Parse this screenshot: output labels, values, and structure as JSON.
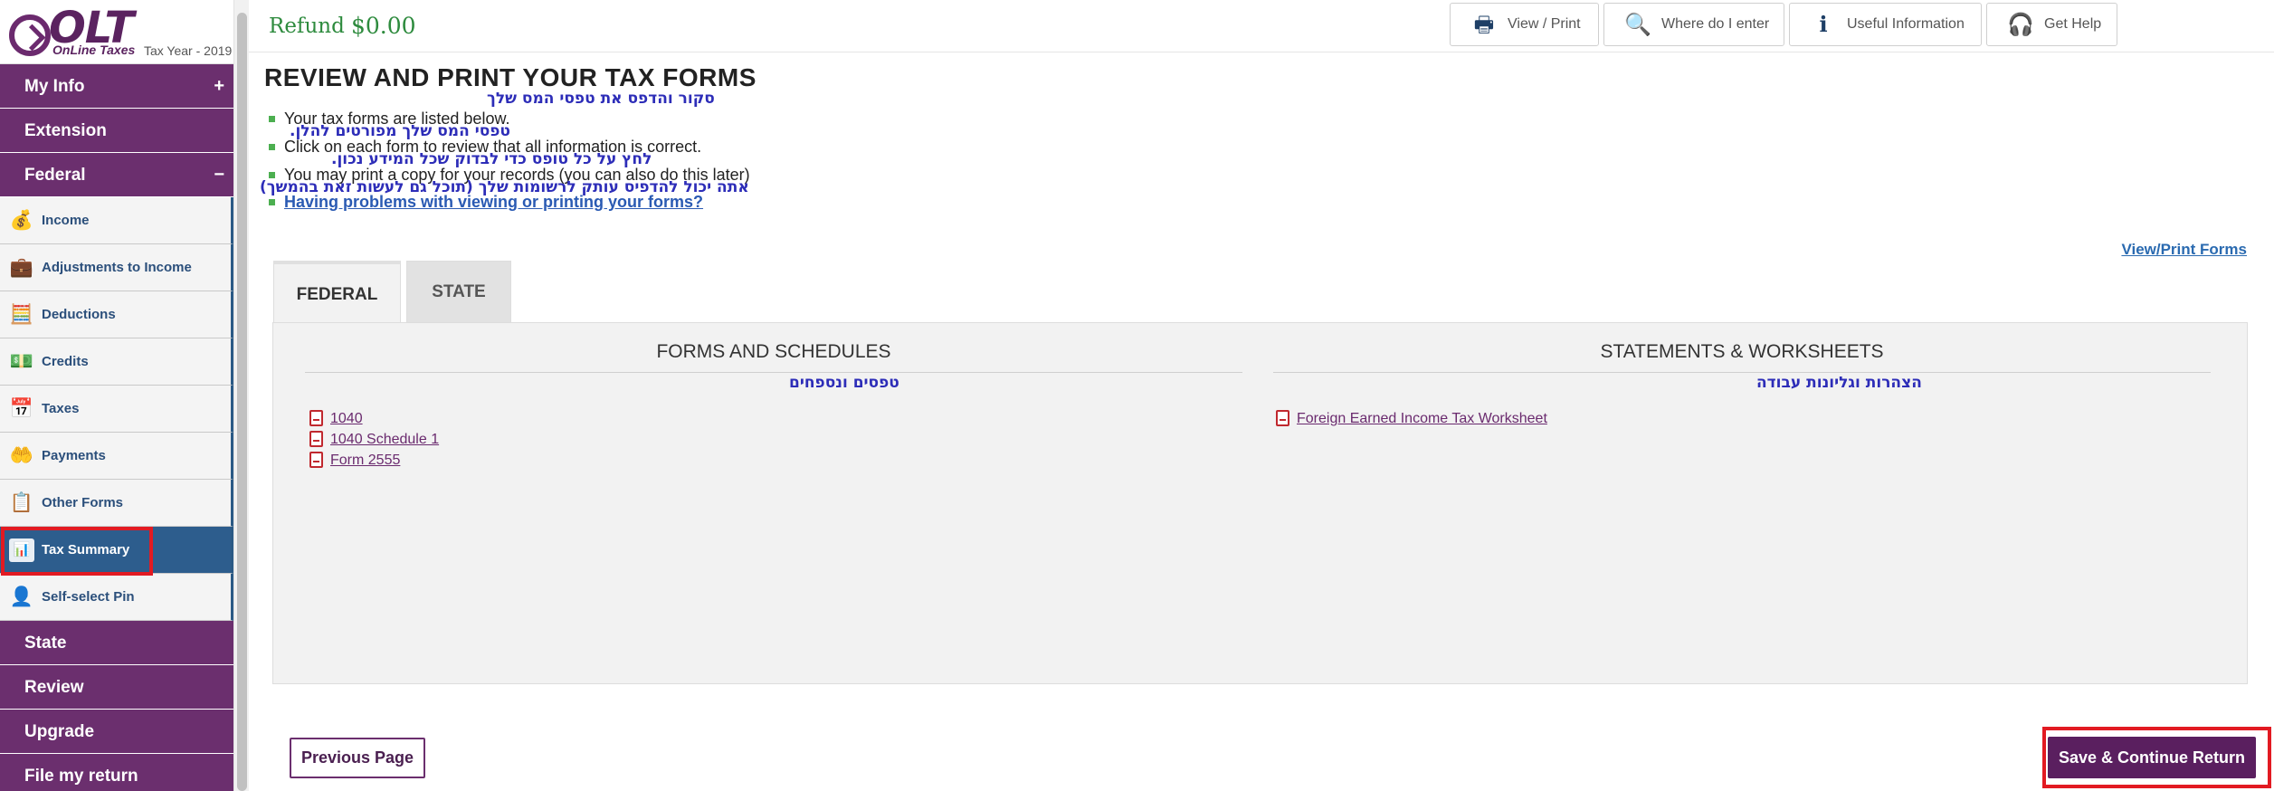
{
  "logo": {
    "brand": "OLT",
    "tagline": "OnLine Taxes",
    "tax_year": "Tax Year - 2019"
  },
  "sidebar": {
    "items": [
      {
        "label": "My Info",
        "type": "main",
        "sign": "+"
      },
      {
        "label": "Extension",
        "type": "main",
        "sign": ""
      },
      {
        "label": "Federal",
        "type": "main",
        "sign": "−"
      },
      {
        "label": "Income",
        "type": "sub",
        "icon": "money-bag-icon",
        "glyph": "💰"
      },
      {
        "label": "Adjustments to Income",
        "type": "sub",
        "icon": "briefcase-icon",
        "glyph": "💼"
      },
      {
        "label": "Deductions",
        "type": "sub",
        "icon": "calculator-icon",
        "glyph": "🧮"
      },
      {
        "label": "Credits",
        "type": "sub",
        "icon": "cash-stack-icon",
        "glyph": "💵"
      },
      {
        "label": "Taxes",
        "type": "sub",
        "icon": "tax-calendar-icon",
        "glyph": "📅"
      },
      {
        "label": "Payments",
        "type": "sub",
        "icon": "payment-hand-icon",
        "glyph": "🤲"
      },
      {
        "label": "Other Forms",
        "type": "sub",
        "icon": "clipboard-icon",
        "glyph": "📋"
      },
      {
        "label": "Tax Summary",
        "type": "sub",
        "icon": "chart-icon",
        "glyph": "📊",
        "active": true
      },
      {
        "label": "Self-select Pin",
        "type": "sub",
        "icon": "person-pin-icon",
        "glyph": "👤"
      },
      {
        "label": "State",
        "type": "main",
        "sign": ""
      },
      {
        "label": "Review",
        "type": "main",
        "sign": ""
      },
      {
        "label": "Upgrade",
        "type": "main",
        "sign": ""
      },
      {
        "label": "File my return",
        "type": "main",
        "sign": ""
      }
    ]
  },
  "topbar": {
    "refund_label": "Refund",
    "refund_value": "$0.00",
    "buttons": [
      {
        "label": "View / Print",
        "icon": "printer-icon",
        "glyph": "🖶"
      },
      {
        "label": "Where do I enter",
        "icon": "search-icon",
        "glyph": "🔍"
      },
      {
        "label": "Useful Information",
        "icon": "info-icon",
        "glyph": "ℹ"
      },
      {
        "label": "Get Help",
        "icon": "help-agent-icon",
        "glyph": "🎧"
      }
    ]
  },
  "main": {
    "title": "REVIEW AND PRINT YOUR TAX FORMS",
    "title_hebrew": "סקור והדפס את טפסי המס שלך",
    "bullets": [
      {
        "text": "Your tax forms are listed below.",
        "hebrew": "טפסי המס שלך מפורטים להלן."
      },
      {
        "text": "Click on each form to review that all information is correct.",
        "hebrew": "לחץ על כל טופס כדי לבדוק שכל המידע נכון."
      },
      {
        "text": "You may print a copy for your records (you can also do this later)",
        "hebrew": "אתה יכול להדפיס עותק לרשומות שלך (תוכל גם לעשות זאת בהמשך)"
      }
    ],
    "help_link": "Having problems with viewing or printing your forms?",
    "view_print_forms": "View/Print Forms",
    "tabs": [
      {
        "label": "FEDERAL",
        "active": true
      },
      {
        "label": "STATE",
        "active": false
      }
    ],
    "forms_heading": "FORMS AND SCHEDULES",
    "forms_heading_hebrew": "טפסים ונספחים",
    "forms": [
      "1040",
      "1040 Schedule 1",
      "Form 2555"
    ],
    "statements_heading": "STATEMENTS & WORKSHEETS",
    "statements_heading_hebrew": "הצהרות וגליונות עבודה",
    "statements": [
      "Foreign Earned Income Tax Worksheet"
    ],
    "prev_button": "Previous Page",
    "save_button": "Save & Continue Return"
  },
  "colors": {
    "sidebar_main": "#6b2f6e",
    "sidebar_active": "#2d5d8d",
    "refund": "#2e8b3e",
    "highlight": "#e21a22"
  }
}
